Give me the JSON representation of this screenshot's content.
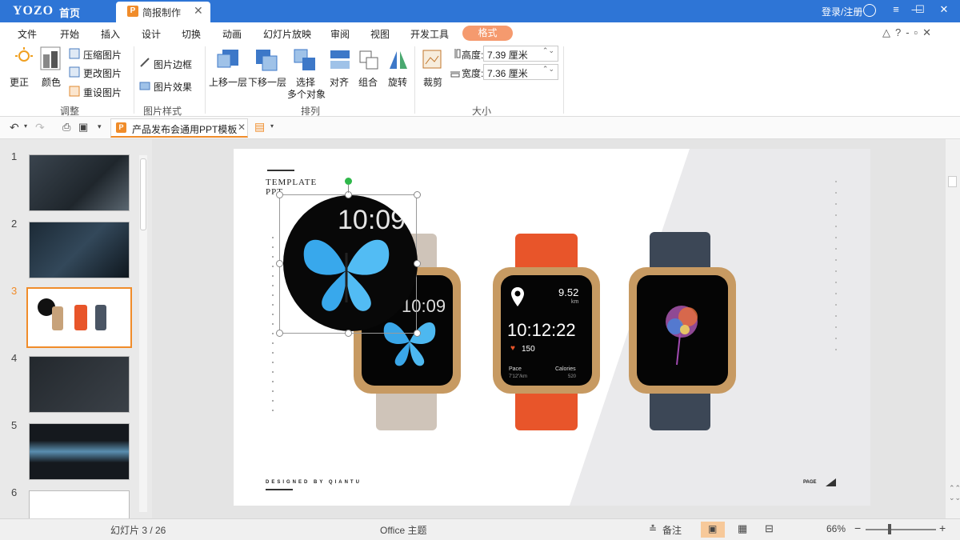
{
  "titlebar": {
    "logo": "YOZO",
    "home": "首页",
    "doc_tab": "简报制作",
    "login": "登录/注册"
  },
  "menu": [
    "文件",
    "开始",
    "插入",
    "设计",
    "切换",
    "动画",
    "幻灯片放映",
    "审阅",
    "视图",
    "开发工具",
    "格式"
  ],
  "ribbon": {
    "adjust": {
      "correct": "更正",
      "color": "颜色",
      "compress": "压缩图片",
      "change": "更改图片",
      "reset": "重设图片",
      "group": "调整"
    },
    "style": {
      "border": "图片边框",
      "effect": "图片效果",
      "group": "图片样式"
    },
    "arrange": {
      "bring_forward": "上移一层",
      "send_backward": "下移一层",
      "select_line1": "选择",
      "select_line2": "多个对象",
      "align": "对齐",
      "group_btn": "组合",
      "rotate": "旋转",
      "group": "排列"
    },
    "size": {
      "crop": "裁剪",
      "height_label": "高度:",
      "height_value": "7.39 厘米",
      "width_label": "宽度:",
      "width_value": "7.36 厘米",
      "group": "大小"
    }
  },
  "doc_tab": "产品发布会通用PPT模板",
  "slides": {
    "numbers": [
      "1",
      "2",
      "3",
      "4",
      "5",
      "6"
    ],
    "selected": "3"
  },
  "slide": {
    "template_line1": "TEMPLATE",
    "template_line2": "PPT",
    "time_big": "10:09",
    "time_small": "10:09",
    "distance": "9.52",
    "distance_unit": "km",
    "elapsed": "10:12:22",
    "heart": "150",
    "pace_label": "Pace",
    "pace_value": "7'12\"/km",
    "cal_label": "Calories",
    "cal_value": "520",
    "footer": "DESIGNED BY QIANTU",
    "page_label": "PAGE"
  },
  "status": {
    "slide_info": "幻灯片 3 / 26",
    "theme": "Office 主题",
    "notes": "备注",
    "zoom": "66%"
  },
  "colors": {
    "title_blue": "#2e75d6",
    "accent_orange": "#f08c2a",
    "format_tab": "#f59a6e",
    "strap_orange": "#e8552a",
    "strap_navy": "#3c4756",
    "strap_beige": "#cfc4b9"
  }
}
